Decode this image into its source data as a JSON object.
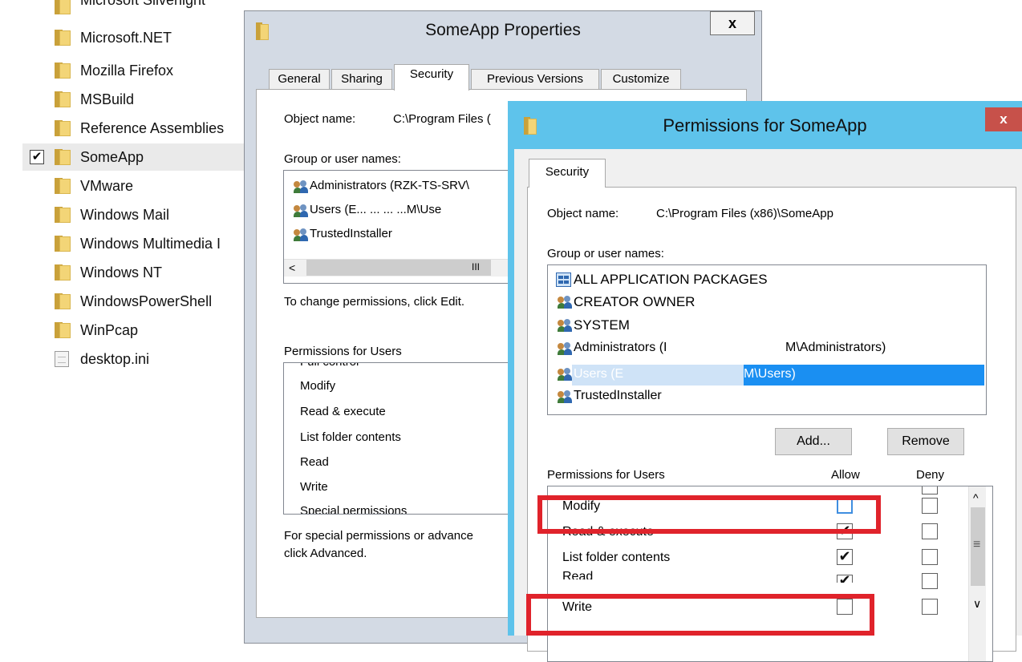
{
  "explorer": {
    "items": [
      {
        "name": "Microsoft Silverlight",
        "type": "folder"
      },
      {
        "name": "Microsoft.NET",
        "type": "folder"
      },
      {
        "name": "Mozilla Firefox",
        "type": "folder"
      },
      {
        "name": "MSBuild",
        "type": "folder"
      },
      {
        "name": "Reference Assemblies",
        "type": "folder"
      },
      {
        "name": "SomeApp",
        "type": "folder",
        "selected": true,
        "checked": true
      },
      {
        "name": "VMware",
        "type": "folder"
      },
      {
        "name": "Windows Mail",
        "type": "folder"
      },
      {
        "name": "Windows Multimedia I",
        "type": "folder"
      },
      {
        "name": "Windows NT",
        "type": "folder"
      },
      {
        "name": "WindowsPowerShell",
        "type": "folder"
      },
      {
        "name": "WinPcap",
        "type": "folder"
      },
      {
        "name": "desktop.ini",
        "type": "file"
      }
    ],
    "checkmark": "✔"
  },
  "properties": {
    "title": "SomeApp Properties",
    "close": "x",
    "tabs": [
      "General",
      "Sharing",
      "Security",
      "Previous Versions",
      "Customize"
    ],
    "object_label": "Object name:",
    "object_value": "C:\\Program Files (",
    "group_label": "Group or user names:",
    "users": [
      "Administrators (RZK-TS-SRV\\",
      "Users (E... ... ... ...M\\Use",
      "TrustedInstaller"
    ],
    "scroll_left": "<",
    "scroll_thumb": "III",
    "change_text": "To change permissions, click Edit.",
    "perm_label": "Permissions for Users",
    "perms": [
      "Full control",
      "Modify",
      "Read & execute",
      "List folder contents",
      "Read",
      "Write",
      "Special permissions"
    ],
    "special_text_1": "For special permissions or advance",
    "special_text_2": "click Advanced."
  },
  "permissions": {
    "title": "Permissions for SomeApp",
    "close": "x",
    "tab": "Security",
    "object_label": "Object name:",
    "object_value": "C:\\Program Files (x86)\\SomeApp",
    "group_label": "Group or user names:",
    "users": [
      {
        "name": "ALL APPLICATION PACKAGES",
        "icon": "packages-icon"
      },
      {
        "name": "CREATOR OWNER",
        "icon": "users-icon"
      },
      {
        "name": "SYSTEM",
        "icon": "users-icon"
      },
      {
        "name": "Administrators (I",
        "suffix": "M\\Administrators)",
        "icon": "users-icon"
      },
      {
        "name": "Users (E",
        "suffix": "M\\Users)",
        "icon": "users-icon",
        "selected": true
      },
      {
        "name": "TrustedInstaller",
        "icon": "users-icon"
      }
    ],
    "add_button": "Add...",
    "remove_button": "Remove",
    "perm_label": "Permissions for Users",
    "allow_label": "Allow",
    "deny_label": "Deny",
    "perms": [
      {
        "name": "Modify",
        "allow": false,
        "deny": false
      },
      {
        "name": "Read & execute",
        "allow": true,
        "deny": false
      },
      {
        "name": "List folder contents",
        "allow": true,
        "deny": false
      },
      {
        "name": "Read",
        "allow": true,
        "deny": false
      },
      {
        "name": "Write",
        "allow": false,
        "deny": false
      }
    ],
    "check_glyph": "✔",
    "scroll_up": "^",
    "scroll_thumb": "≡",
    "scroll_down": "∨",
    "highlight_color": "#e0232b"
  }
}
